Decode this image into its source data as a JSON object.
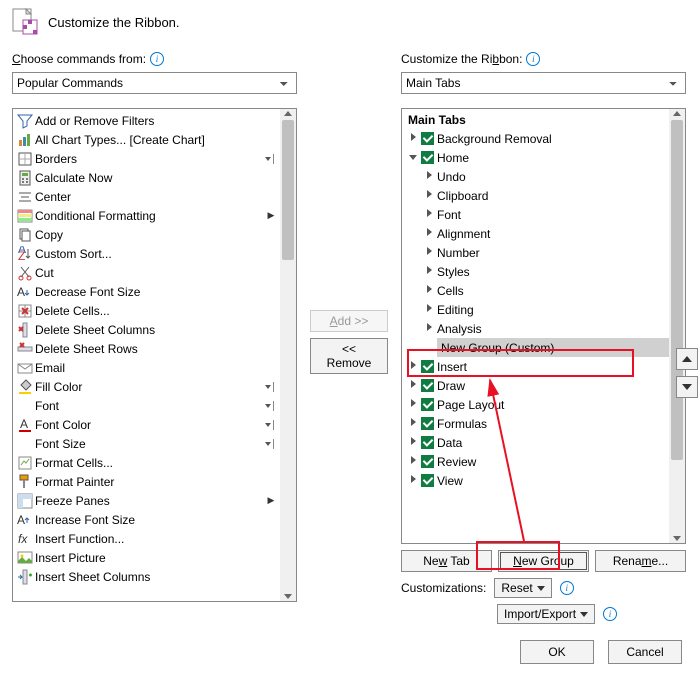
{
  "header": {
    "title": "Customize the Ribbon."
  },
  "left": {
    "label_pre": "",
    "label_u": "C",
    "label_post": "hoose commands from:",
    "combo": "Popular Commands",
    "items": [
      {
        "icon": "filter",
        "label": "Add or Remove Filters"
      },
      {
        "icon": "chart",
        "label": "All Chart Types... [Create Chart]"
      },
      {
        "icon": "borders",
        "label": "Borders",
        "sub": "split"
      },
      {
        "icon": "calc",
        "label": "Calculate Now"
      },
      {
        "icon": "center",
        "label": "Center"
      },
      {
        "icon": "condfmt",
        "label": "Conditional Formatting",
        "sub": "arrow"
      },
      {
        "icon": "copy",
        "label": "Copy"
      },
      {
        "icon": "sort",
        "label": "Custom Sort..."
      },
      {
        "icon": "cut",
        "label": "Cut"
      },
      {
        "icon": "fontdec",
        "label": "Decrease Font Size"
      },
      {
        "icon": "delcells",
        "label": "Delete Cells..."
      },
      {
        "icon": "delcols",
        "label": "Delete Sheet Columns"
      },
      {
        "icon": "delrows",
        "label": "Delete Sheet Rows"
      },
      {
        "icon": "email",
        "label": "Email"
      },
      {
        "icon": "fill",
        "label": "Fill Color",
        "sub": "split"
      },
      {
        "icon": "font",
        "label": "Font",
        "sub": "split"
      },
      {
        "icon": "fontcolor",
        "label": "Font Color",
        "sub": "split"
      },
      {
        "icon": "fontsize",
        "label": "Font Size",
        "sub": "split"
      },
      {
        "icon": "fmtcells",
        "label": "Format Cells..."
      },
      {
        "icon": "painter",
        "label": "Format Painter"
      },
      {
        "icon": "freeze",
        "label": "Freeze Panes",
        "sub": "arrow"
      },
      {
        "icon": "fontinc",
        "label": "Increase Font Size"
      },
      {
        "icon": "fx",
        "label": "Insert Function..."
      },
      {
        "icon": "picture",
        "label": "Insert Picture"
      },
      {
        "icon": "inscols",
        "label": "Insert Sheet Columns"
      }
    ]
  },
  "mid": {
    "add_pre": "",
    "add_u": "A",
    "add_post": "dd >>",
    "remove": "<< Remove"
  },
  "right": {
    "label_pre": "Customize the Ri",
    "label_u": "b",
    "label_post": "bon:",
    "combo": "Main Tabs",
    "tree_header": "Main Tabs",
    "tabs": [
      {
        "label": "Background Removal",
        "expanded": false
      },
      {
        "label": "Home",
        "expanded": true,
        "groups": [
          "Undo",
          "Clipboard",
          "Font",
          "Alignment",
          "Number",
          "Styles",
          "Cells",
          "Editing",
          "Analysis"
        ],
        "custom": "New Group (Custom)"
      },
      {
        "label": "Insert",
        "expanded": false
      },
      {
        "label": "Draw",
        "expanded": false
      },
      {
        "label": "Page Layout",
        "expanded": false
      },
      {
        "label": "Formulas",
        "expanded": false
      },
      {
        "label": "Data",
        "expanded": false
      },
      {
        "label": "Review",
        "expanded": false
      },
      {
        "label": "View",
        "expanded": false
      }
    ],
    "btn_newtab_pre": "Ne",
    "btn_newtab_u": "w",
    "btn_newtab_post": " Tab",
    "btn_newgroup_pre": "",
    "btn_newgroup_u": "N",
    "btn_newgroup_post": "ew Group",
    "btn_rename_pre": "Rena",
    "btn_rename_u": "m",
    "btn_rename_post": "e...",
    "cust_label": "Customizations:",
    "reset": "Reset",
    "importexport": "Import/Export"
  },
  "footer": {
    "ok": "OK",
    "cancel": "Cancel"
  }
}
